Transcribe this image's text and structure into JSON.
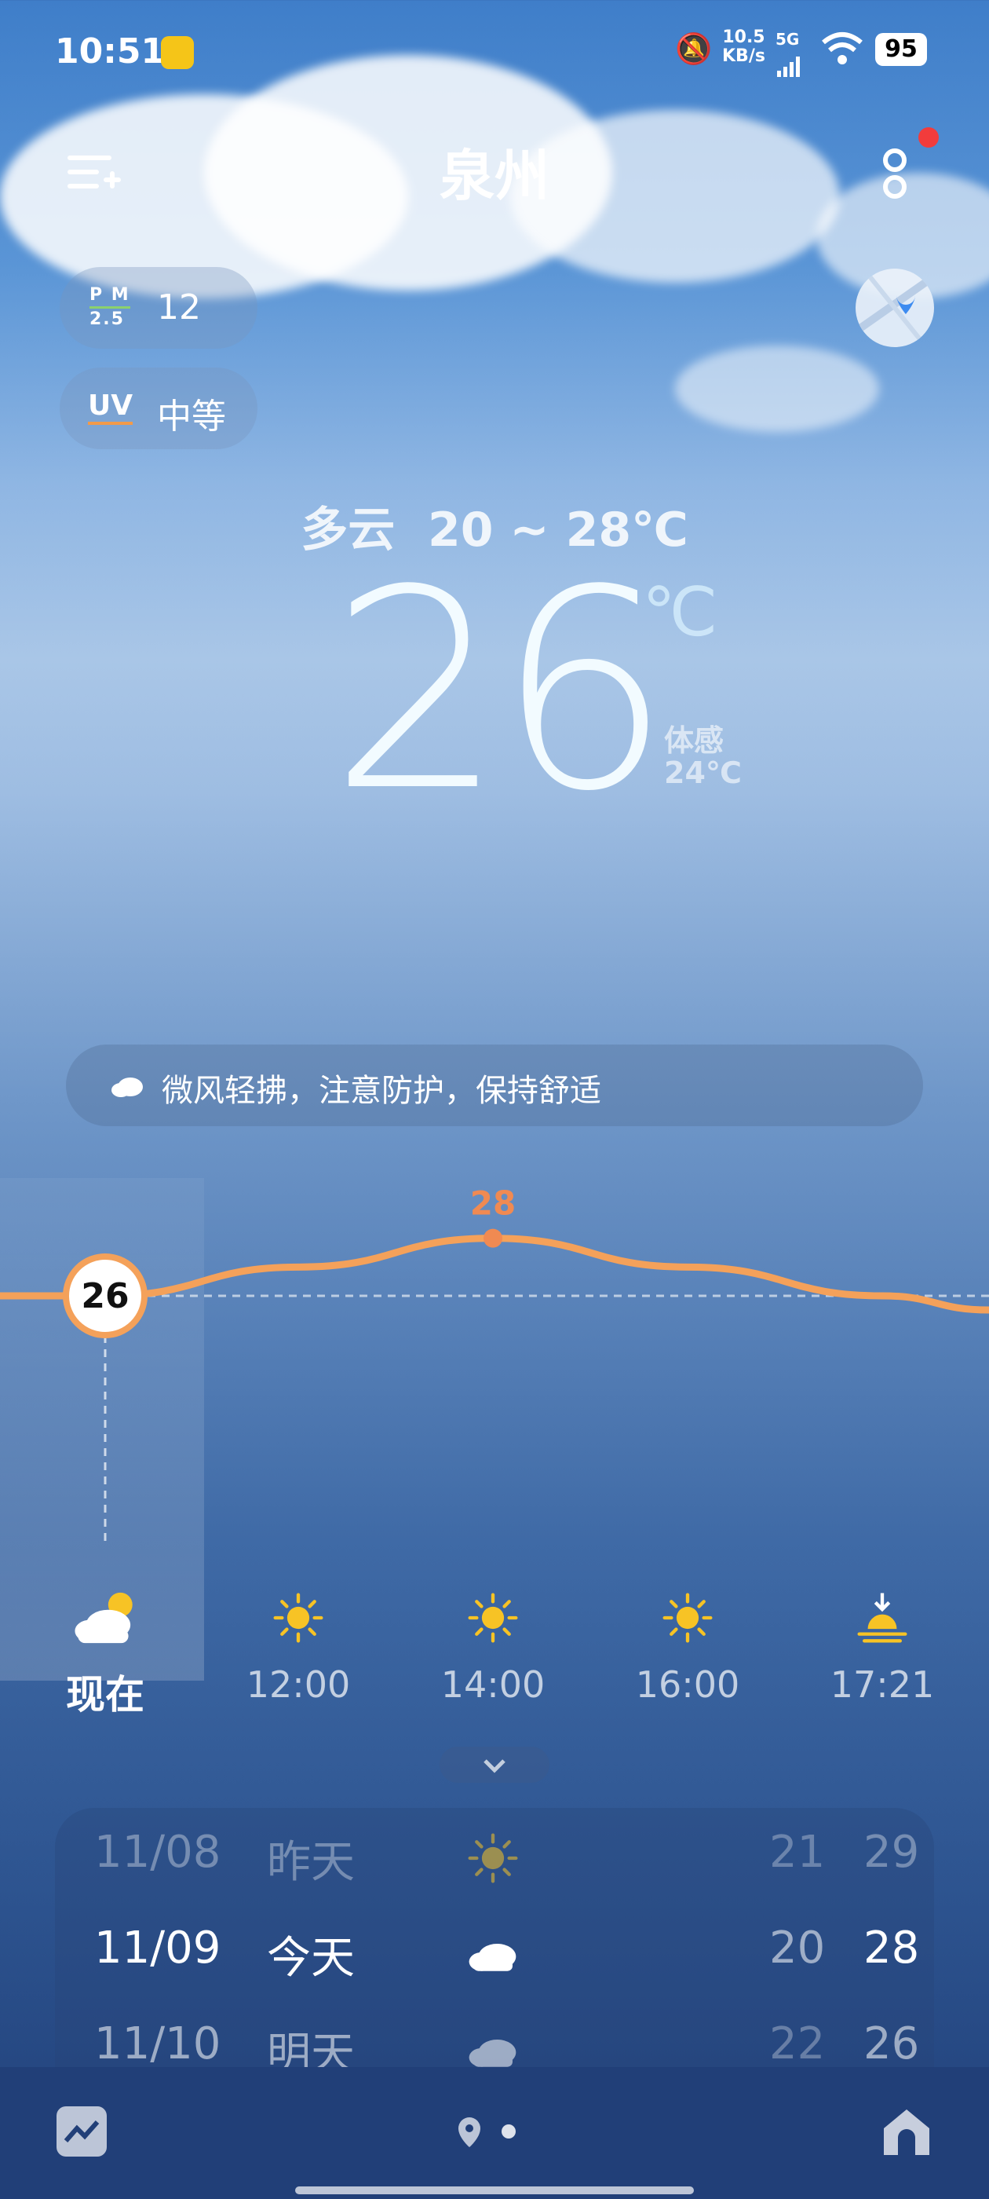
{
  "status_bar": {
    "time": "10:51",
    "net_speed": "10.5",
    "net_unit": "KB/s",
    "signal_label": "5G",
    "battery": "95"
  },
  "header": {
    "city": "泉州"
  },
  "air": {
    "pm_label_top": "P M",
    "pm_label_bottom": "2.5",
    "pm_value": "12",
    "uv_label": "UV",
    "uv_value": "中等"
  },
  "summary": {
    "condition": "多云",
    "range": "20 ~ 28℃"
  },
  "current": {
    "temp": "26",
    "unit": "℃",
    "feels_label": "体感",
    "feels_value": "24℃"
  },
  "tip": {
    "text": "微风轻拂，注意防护，保持舒适"
  },
  "chart_data": {
    "type": "line",
    "title": "",
    "xlabel": "",
    "ylabel": "",
    "categories": [
      "现在",
      "12:00",
      "14:00",
      "16:00",
      "17:21"
    ],
    "values": [
      26,
      27,
      28,
      27,
      26
    ],
    "labels": {
      "current": "26",
      "max": "28"
    },
    "colors": {
      "line": "#f4a15a",
      "max_label": "#f08a52"
    }
  },
  "hourly": [
    {
      "time": "现在",
      "icon": "partly-cloudy-icon"
    },
    {
      "time": "12:00",
      "icon": "sun-icon"
    },
    {
      "time": "14:00",
      "icon": "sun-icon"
    },
    {
      "time": "16:00",
      "icon": "sun-icon"
    },
    {
      "time": "17:21",
      "icon": "sunset-icon"
    }
  ],
  "daily": [
    {
      "date": "11/08",
      "day": "昨天",
      "icon": "sun-icon",
      "low": "21",
      "high": "29"
    },
    {
      "date": "11/09",
      "day": "今天",
      "icon": "cloud-icon",
      "low": "20",
      "high": "28"
    },
    {
      "date": "11/10",
      "day": "明天",
      "icon": "cloud-icon",
      "low": "22",
      "high": "26"
    }
  ],
  "colors": {
    "accent_sun": "#f7c325",
    "notification_dot": "#f23c3c"
  }
}
